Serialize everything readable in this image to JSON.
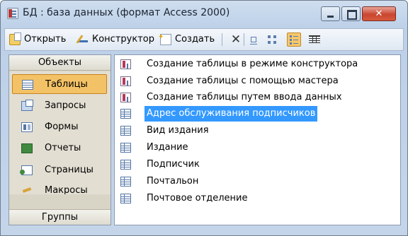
{
  "window": {
    "title": "БД : база данных (формат Access 2000)",
    "close_glyph": "✕"
  },
  "toolbar": {
    "open_label": "Открыть",
    "design_label": "Конструктор",
    "new_label": "Создать",
    "delete_glyph": "✕"
  },
  "objects_panel": {
    "header": "Объекты",
    "items": [
      {
        "label": "Таблицы",
        "icon": "table-icon",
        "selected": true
      },
      {
        "label": "Запросы",
        "icon": "query-icon"
      },
      {
        "label": "Формы",
        "icon": "form-icon"
      },
      {
        "label": "Отчеты",
        "icon": "report-icon"
      },
      {
        "label": "Страницы",
        "icon": "page-icon"
      },
      {
        "label": "Макросы",
        "icon": "macro-icon"
      }
    ],
    "groups_label": "Группы"
  },
  "list": {
    "items": [
      {
        "label": "Создание таблицы в режиме конструктора",
        "icon": "wizard-icon"
      },
      {
        "label": "Создание таблицы с помощью мастера",
        "icon": "wizard-icon"
      },
      {
        "label": "Создание таблицы путем ввода данных",
        "icon": "wizard-icon"
      },
      {
        "label": "Адрес обслуживания подписчиков",
        "icon": "table-icon",
        "selected": true
      },
      {
        "label": "Вид издания",
        "icon": "table-icon"
      },
      {
        "label": "Издание",
        "icon": "table-icon"
      },
      {
        "label": "Подписчик",
        "icon": "table-icon"
      },
      {
        "label": "Почтальон",
        "icon": "table-icon"
      },
      {
        "label": "Почтовое отделение",
        "icon": "table-icon"
      }
    ]
  },
  "colors": {
    "selection_blue": "#3399ff",
    "selection_orange": "#f4c266"
  }
}
